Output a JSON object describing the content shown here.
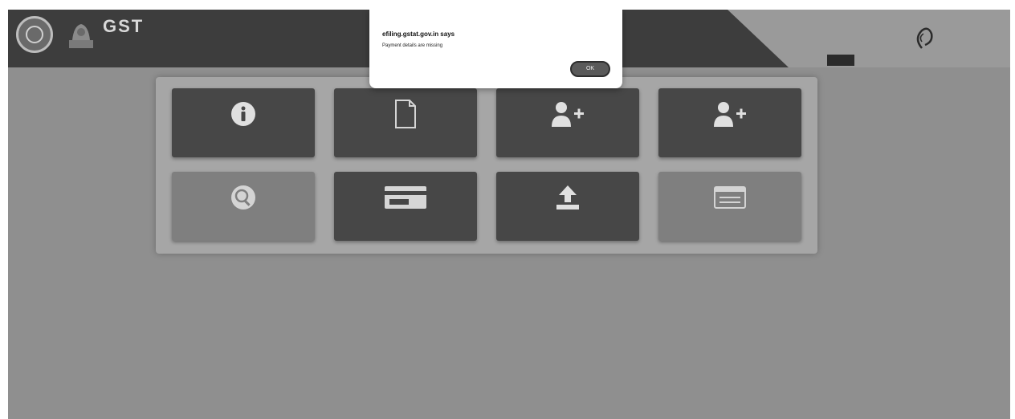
{
  "header": {
    "logo_title": "GST",
    "logo_subtitle_line1": "",
    "logo_subtitle_line2": "",
    "help_logo_text": "",
    "nav_links": [
      {
        "label": "",
        "name": "nav-link-1"
      },
      {
        "label": "",
        "name": "nav-link-2"
      },
      {
        "label": "",
        "name": "nav-link-3"
      }
    ]
  },
  "tiles": [
    {
      "name": "tile-basic-details",
      "label": "",
      "icon": "info-icon",
      "style": "dark"
    },
    {
      "name": "tile-document",
      "label": "",
      "icon": "document-icon",
      "style": "dark"
    },
    {
      "name": "tile-add-registration",
      "label": "",
      "icon": "add-user-icon",
      "style": "dark"
    },
    {
      "name": "tile-add-user-2",
      "label": "",
      "icon": "add-user-icon",
      "style": "dark"
    },
    {
      "name": "tile-search",
      "label": "",
      "icon": "search-icon",
      "style": "light"
    },
    {
      "name": "tile-payment",
      "label": "",
      "icon": "card-icon",
      "style": "dark"
    },
    {
      "name": "tile-upload-document",
      "label": "",
      "icon": "upload-icon",
      "style": "dark"
    },
    {
      "name": "tile-view",
      "label": "",
      "icon": "window-icon",
      "style": "light"
    }
  ],
  "dialog": {
    "title": "efiling.gstat.gov.in says",
    "message": "Payment details are missing",
    "ok_label": "OK"
  },
  "colors": {
    "header": "#3d3d3d",
    "page_background": "#8f8f8f",
    "tile_dark": "#474747",
    "tile_light": "#7f7f7f",
    "dialog_background": "#ffffff"
  }
}
